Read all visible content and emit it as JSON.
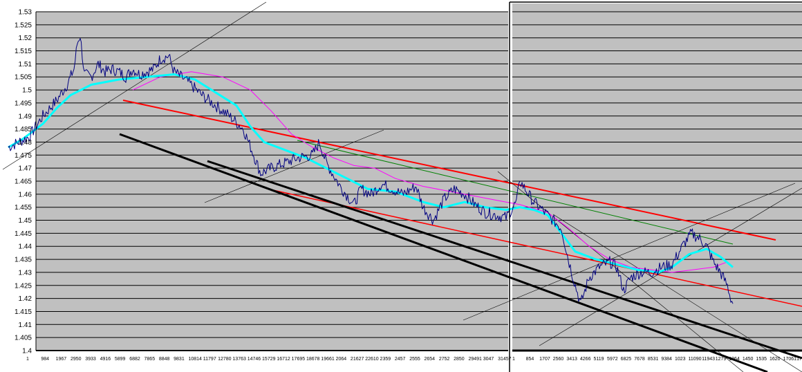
{
  "chart_data": {
    "type": "line",
    "title": "",
    "xlabel": "",
    "ylabel": "",
    "ylim": [
      1.4,
      1.53
    ],
    "grid": true,
    "legend": "none",
    "y_ticks": [
      "1.53",
      "1.525",
      "1.52",
      "1.515",
      "1.51",
      "1.505",
      "1.5",
      "1.495",
      "1.49",
      "1.485",
      "1.48",
      "1.475",
      "1.47",
      "1.465",
      "1.46",
      "1.455",
      "1.45",
      "1.445",
      "1.44",
      "1.435",
      "1.43",
      "1.425",
      "1.42",
      "1.415",
      "1.41",
      "1.405",
      "1.4"
    ],
    "colors": {
      "plot_bg": "#c0c0c0",
      "price": "#000080",
      "ma_fast": "#00ffff",
      "ma_slow": "#ff00ff",
      "channel": "#ff0000",
      "green_line": "#008000",
      "support": "#000000",
      "grid": "#000000"
    },
    "panels": [
      {
        "name": "left",
        "x_ticks": [
          "1",
          "984",
          "1967",
          "2950",
          "3933",
          "4916",
          "5899",
          "6882",
          "7865",
          "8848",
          "9831",
          "10814",
          "11797",
          "12780",
          "13763",
          "14746",
          "15729",
          "16712",
          "17695",
          "18678",
          "19661",
          "2064",
          "21627",
          "22610",
          "2359",
          "2457",
          "2555",
          "2654",
          "2752",
          "2850",
          "29491",
          "3047",
          "31457"
        ],
        "price": [
          [
            0,
            1.478
          ],
          [
            30,
            1.482
          ],
          [
            50,
            1.49
          ],
          [
            70,
            1.496
          ],
          [
            85,
            1.502
          ],
          [
            95,
            1.508
          ],
          [
            100,
            1.518
          ],
          [
            104,
            1.521
          ],
          [
            110,
            1.506
          ],
          [
            120,
            1.505
          ],
          [
            130,
            1.51
          ],
          [
            140,
            1.507
          ],
          [
            150,
            1.508
          ],
          [
            160,
            1.507
          ],
          [
            170,
            1.505
          ],
          [
            180,
            1.508
          ],
          [
            190,
            1.506
          ],
          [
            200,
            1.507
          ],
          [
            210,
            1.508
          ],
          [
            220,
            1.512
          ],
          [
            232,
            1.513
          ],
          [
            240,
            1.507
          ],
          [
            260,
            1.503
          ],
          [
            280,
            1.498
          ],
          [
            300,
            1.494
          ],
          [
            320,
            1.49
          ],
          [
            340,
            1.485
          ],
          [
            355,
            1.475
          ],
          [
            365,
            1.468
          ],
          [
            380,
            1.47
          ],
          [
            400,
            1.472
          ],
          [
            420,
            1.474
          ],
          [
            440,
            1.475
          ],
          [
            450,
            1.48
          ],
          [
            460,
            1.472
          ],
          [
            480,
            1.463
          ],
          [
            500,
            1.456
          ],
          [
            510,
            1.462
          ],
          [
            525,
            1.46
          ],
          [
            540,
            1.464
          ],
          [
            555,
            1.462
          ],
          [
            570,
            1.46
          ],
          [
            590,
            1.463
          ],
          [
            600,
            1.455
          ],
          [
            615,
            1.45
          ],
          [
            630,
            1.458
          ],
          [
            645,
            1.462
          ],
          [
            660,
            1.46
          ],
          [
            675,
            1.456
          ],
          [
            690,
            1.453
          ],
          [
            705,
            1.452
          ],
          [
            720,
            1.451
          ],
          [
            735,
            1.457
          ],
          [
            740,
            1.465
          ]
        ],
        "ma_fast": [
          [
            0,
            1.478
          ],
          [
            20,
            1.481
          ],
          [
            50,
            1.487
          ],
          [
            70,
            1.493
          ],
          [
            90,
            1.498
          ],
          [
            120,
            1.502
          ],
          [
            160,
            1.504
          ],
          [
            200,
            1.505
          ],
          [
            240,
            1.506
          ],
          [
            270,
            1.504
          ],
          [
            300,
            1.499
          ],
          [
            330,
            1.494
          ],
          [
            350,
            1.486
          ],
          [
            370,
            1.48
          ],
          [
            400,
            1.477
          ],
          [
            430,
            1.474
          ],
          [
            460,
            1.47
          ],
          [
            490,
            1.466
          ],
          [
            520,
            1.462
          ],
          [
            560,
            1.461
          ],
          [
            600,
            1.457
          ],
          [
            630,
            1.455
          ],
          [
            660,
            1.457
          ],
          [
            690,
            1.455
          ],
          [
            720,
            1.454
          ],
          [
            740,
            1.455
          ]
        ],
        "ma_slow": [
          [
            180,
            1.5
          ],
          [
            220,
            1.505
          ],
          [
            265,
            1.507
          ],
          [
            310,
            1.505
          ],
          [
            350,
            1.5
          ],
          [
            380,
            1.492
          ],
          [
            410,
            1.483
          ],
          [
            440,
            1.478
          ],
          [
            470,
            1.474
          ],
          [
            500,
            1.471
          ],
          [
            530,
            1.47
          ],
          [
            560,
            1.466
          ],
          [
            600,
            1.463
          ],
          [
            640,
            1.461
          ],
          [
            680,
            1.459
          ],
          [
            720,
            1.457
          ],
          [
            740,
            1.456
          ]
        ]
      },
      {
        "name": "right",
        "x_ticks": [
          "1",
          "854",
          "1707",
          "2560",
          "3413",
          "4266",
          "5119",
          "5972",
          "6825",
          "7678",
          "8531",
          "9384",
          "1023",
          "11090",
          "11943",
          "1279",
          "1364",
          "1450",
          "1535",
          "1620",
          "17061",
          "17"
        ],
        "price": [
          [
            740,
            1.465
          ],
          [
            760,
            1.457
          ],
          [
            780,
            1.452
          ],
          [
            800,
            1.447
          ],
          [
            810,
            1.435
          ],
          [
            820,
            1.425
          ],
          [
            828,
            1.418
          ],
          [
            840,
            1.428
          ],
          [
            855,
            1.432
          ],
          [
            870,
            1.434
          ],
          [
            880,
            1.432
          ],
          [
            890,
            1.423
          ],
          [
            900,
            1.428
          ],
          [
            915,
            1.43
          ],
          [
            930,
            1.43
          ],
          [
            945,
            1.432
          ],
          [
            960,
            1.433
          ],
          [
            975,
            1.44
          ],
          [
            988,
            1.445
          ],
          [
            1000,
            1.443
          ],
          [
            1010,
            1.44
          ],
          [
            1020,
            1.434
          ],
          [
            1030,
            1.43
          ],
          [
            1040,
            1.425
          ],
          [
            1045,
            1.42
          ],
          [
            1048,
            1.418
          ]
        ],
        "ma_fast": [
          [
            740,
            1.455
          ],
          [
            760,
            1.454
          ],
          [
            780,
            1.452
          ],
          [
            800,
            1.445
          ],
          [
            820,
            1.438
          ],
          [
            850,
            1.435
          ],
          [
            880,
            1.433
          ],
          [
            910,
            1.431
          ],
          [
            940,
            1.43
          ],
          [
            960,
            1.432
          ],
          [
            985,
            1.437
          ],
          [
            1010,
            1.439
          ],
          [
            1030,
            1.436
          ],
          [
            1048,
            1.432
          ]
        ],
        "ma_slow": [
          [
            740,
            1.456
          ],
          [
            780,
            1.453
          ],
          [
            810,
            1.447
          ],
          [
            840,
            1.44
          ],
          [
            870,
            1.435
          ],
          [
            900,
            1.432
          ],
          [
            930,
            1.431
          ],
          [
            960,
            1.43
          ],
          [
            990,
            1.431
          ],
          [
            1020,
            1.432
          ],
          [
            1040,
            1.434
          ],
          [
            1048,
            1.432
          ]
        ]
      }
    ]
  }
}
